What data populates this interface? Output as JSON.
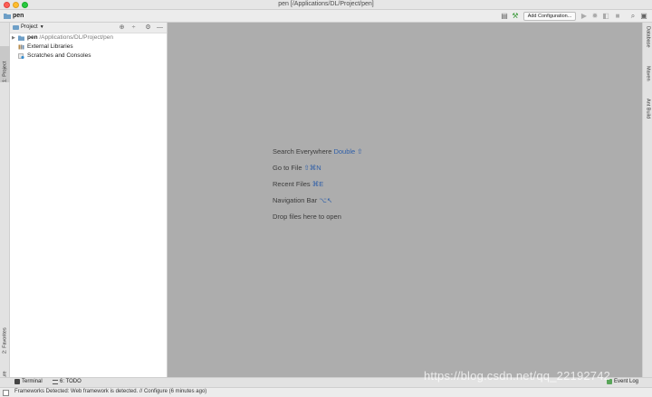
{
  "window": {
    "title": "pen [/Applications/DL/Project/pen]"
  },
  "navbar": {
    "project_name": "pen",
    "add_configuration_label": "Add Configuration...",
    "icons": [
      "structure-icon",
      "build-hammer-icon",
      "run-icon",
      "debug-icon",
      "coverage-icon",
      "stop-icon",
      "search-icon",
      "layout-icon"
    ]
  },
  "left_strip": {
    "project_tab": "1: Project",
    "favorites_tab": "2: Favorites",
    "structure_tab": "Z: Structure"
  },
  "project_panel": {
    "view_selector": "Project",
    "tree": [
      {
        "name": "pen",
        "path": "/Applications/DL/Project/pen",
        "icon": "module-folder-icon"
      },
      {
        "name": "External Libraries",
        "icon": "library-icon"
      },
      {
        "name": "Scratches and Consoles",
        "icon": "scratches-icon"
      }
    ]
  },
  "editor": {
    "hints": [
      {
        "label": "Search Everywhere",
        "shortcut": "Double ⇧"
      },
      {
        "label": "Go to File",
        "shortcut": "⇧⌘N"
      },
      {
        "label": "Recent Files",
        "shortcut": "⌘E"
      },
      {
        "label": "Navigation Bar",
        "shortcut": "⌥↖"
      },
      {
        "label": "Drop files here to open",
        "shortcut": ""
      }
    ]
  },
  "right_strip": {
    "database_tab": "Database",
    "maven_tab": "Maven",
    "ant_tab": "Ant Build"
  },
  "bottom_bar": {
    "terminal_label": "Terminal",
    "todo_label": "6: TODO",
    "event_log_label": "Event Log"
  },
  "status_bar": {
    "message": "Frameworks Detected: Web framework is detected. // Configure (6 minutes ago)"
  },
  "watermark": "https://blog.csdn.net/qq_22192742",
  "colors": {
    "editor_bg": "#adadad",
    "shortcut_blue": "#2f5fa8",
    "folder_blue": "#6e9fc7"
  }
}
